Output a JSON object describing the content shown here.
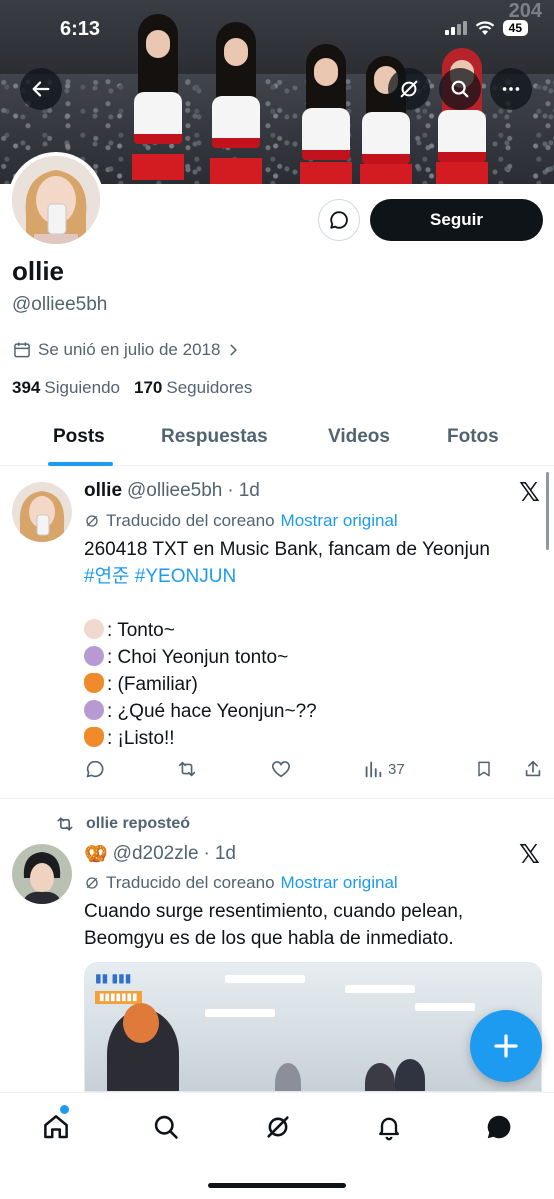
{
  "status_bar": {
    "time": "6:13",
    "battery": "45"
  },
  "banner": {
    "overlay_text": "204"
  },
  "header": {
    "back_icon": "arrow-left-icon",
    "grok_icon": "slash-circle-icon",
    "search_icon": "search-icon",
    "more_icon": "more-horizontal-icon"
  },
  "profile": {
    "name": "ollie",
    "handle": "@olliee5bh",
    "joined": "Se unió en julio de 2018",
    "following_count": "394",
    "following_label": "Siguiendo",
    "followers_count": "170",
    "followers_label": "Seguidores",
    "follow_button": "Seguir"
  },
  "tabs": [
    {
      "label": "Posts",
      "active": true
    },
    {
      "label": "Respuestas",
      "active": false
    },
    {
      "label": "Videos",
      "active": false
    },
    {
      "label": "Fotos",
      "active": false
    }
  ],
  "posts": [
    {
      "name": "ollie",
      "handle": "@olliee5bh",
      "separator": "·",
      "time": "1d",
      "translated_label": "Traducido del coreano",
      "show_original": "Mostrar original",
      "text_line1": "260418 TXT en Music Bank, fancam de Yeonjun",
      "hashtags": "#연준 #YEONJUN",
      "lines": [
        {
          "emoji_color": "#f1d9cf",
          "text": ": Tonto~"
        },
        {
          "emoji_color": "#b69ad1",
          "text": ": Choi Yeonjun tonto~"
        },
        {
          "emoji_color": "#f08a2a",
          "text": ": (Familiar)"
        },
        {
          "emoji_color": "#b69ad1",
          "text": ": ¿Qué hace Yeonjun~??"
        },
        {
          "emoji_color": "#f08a2a",
          "text": ": ¡Listo!!"
        }
      ],
      "views": "37"
    },
    {
      "repost_label": "ollie reposteó",
      "emoji": "🥨",
      "handle": "@d202zle",
      "separator": "·",
      "time": "1d",
      "translated_label": "Traducido del coreano",
      "show_original": "Mostrar original",
      "text_line1": "Cuando surge resentimiento, cuando pelean,",
      "text_line2": "Beomgyu es de los que habla de inmediato."
    }
  ],
  "colors": {
    "accent": "#1d9bf0",
    "text": "#0f1419",
    "muted": "#536471"
  }
}
